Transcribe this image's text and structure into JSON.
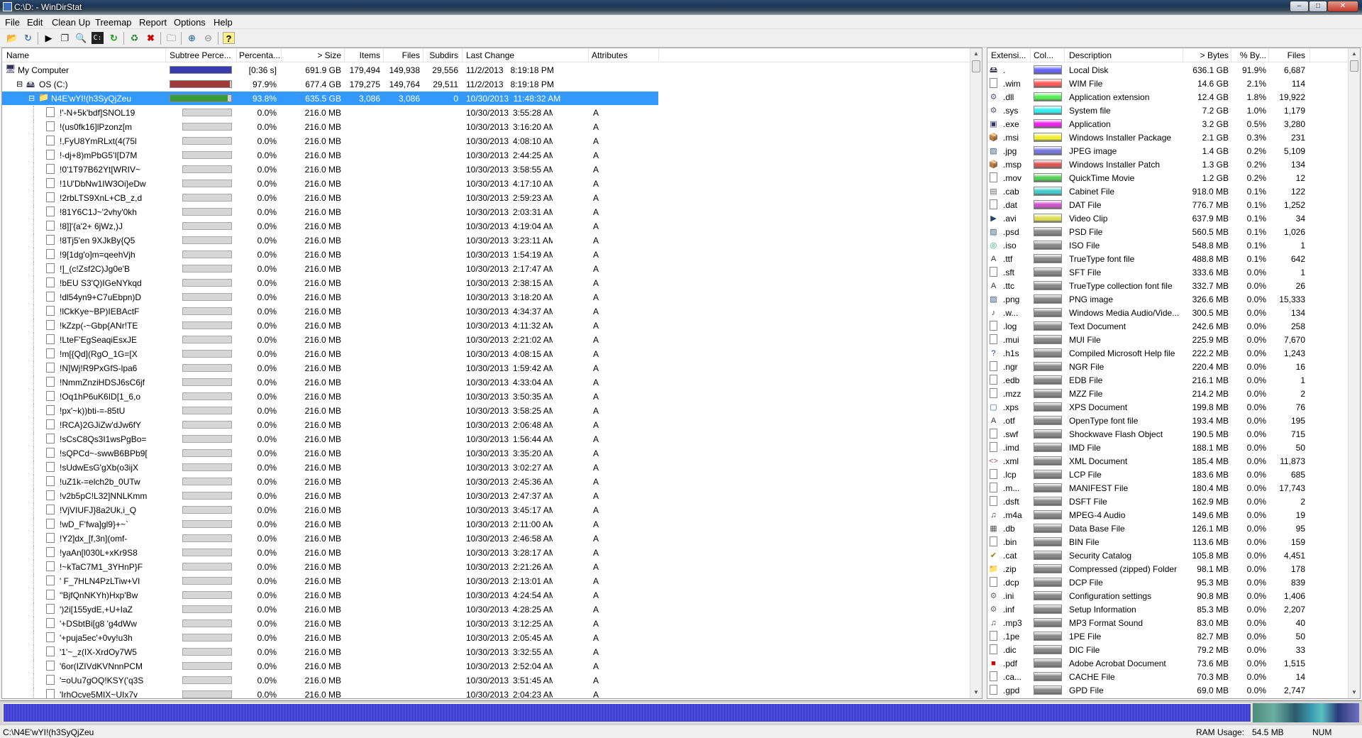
{
  "window": {
    "title": "C:\\D: - WinDirStat"
  },
  "menu": [
    "File",
    "Edit",
    "Clean Up",
    "Treemap",
    "Report",
    "Options",
    "Help"
  ],
  "colors": {
    "computer_bar": "#3b3bb0",
    "drive_bar": "#a03a3a",
    "folder_bar": "#3a9a3a",
    "selection": "#3399ff"
  },
  "toolbar_icons": [
    "open-icon",
    "refresh-all-icon",
    "play-icon",
    "copy-path-icon",
    "explorer-here-icon",
    "command-prompt-icon",
    "refresh-icon",
    "recycle-icon",
    "delete-icon",
    "properties-icon",
    "zoom-in-icon",
    "zoom-out-icon",
    "help-icon"
  ],
  "dir_columns": {
    "name": "Name",
    "subtree": "Subtree Perce...",
    "percent": "Percenta...",
    "size": "> Size",
    "items": "Items",
    "files": "Files",
    "subdirs": "Subdirs",
    "last_change": "Last Change",
    "attributes": "Attributes"
  },
  "tree_top": [
    {
      "name": "My Computer",
      "bar_fill": 1.0,
      "percent": "[0:36 s]",
      "size": "691.9 GB",
      "items": "179,494",
      "files": "149,938",
      "subdirs": "29,556",
      "last_change": "11/2/2013   8:19:18 PM",
      "attributes": "",
      "expand": "",
      "level": 0
    },
    {
      "name": "OS (C:)",
      "bar_fill": 0.979,
      "percent": "97.9%",
      "size": "677.4 GB",
      "items": "179,275",
      "files": "149,764",
      "subdirs": "29,511",
      "last_change": "11/2/2013   8:19:18 PM",
      "attributes": "",
      "expand": "⊟",
      "level": 1
    },
    {
      "name": "N4E'wYI!(h3SyQjZeu",
      "bar_fill": 0.938,
      "percent": "93.8%",
      "size": "635.5 GB",
      "items": "3,086",
      "files": "3,086",
      "subdirs": "0",
      "last_change": "10/30/2013  11:48:32 AM",
      "attributes": "",
      "expand": "⊟",
      "level": 2
    }
  ],
  "files": [
    {
      "name": "!'-N+5k'bdf]SNOL19",
      "time": "3:55:28 AM"
    },
    {
      "name": "!(us0fk16]lPzonz[m",
      "time": "3:16:20 AM"
    },
    {
      "name": "!,FyU8YmRLxt(4(75l",
      "time": "4:08:10 AM"
    },
    {
      "name": "!-dj+8)mPbG5'I[D7M",
      "time": "2:44:25 AM"
    },
    {
      "name": "!0'1T97B62Yt[WRIV~",
      "time": "3:58:55 AM"
    },
    {
      "name": "!1U'DbNw1IW3Oi}eDw",
      "time": "4:17:10 AM"
    },
    {
      "name": "!2rbLTS9XnL+CB_z,d",
      "time": "2:59:23 AM"
    },
    {
      "name": "!81Y6C1J~'2vhy'0kh",
      "time": "2:03:31 AM"
    },
    {
      "name": "!8]]'{a'2+ 6jWz,)J",
      "time": "4:19:04 AM"
    },
    {
      "name": "!8Tj5'en 9XJkBy{Q5",
      "time": "3:23:11 AM"
    },
    {
      "name": "!9[1dg'o]m=qeehVjh",
      "time": "1:54:19 AM"
    },
    {
      "name": "!]_(c!Zsf2C)Jg0e'B",
      "time": "2:17:47 AM"
    },
    {
      "name": "!bEU S3'Q)IGeNYkqd",
      "time": "2:38:15 AM"
    },
    {
      "name": "!dl54yn9+C7uEbpn)D",
      "time": "3:18:20 AM"
    },
    {
      "name": "!lCkKye~BP)IEBActF",
      "time": "4:34:37 AM"
    },
    {
      "name": "!kZzp(-~Gbp{ANr!TE",
      "time": "4:11:32 AM"
    },
    {
      "name": "!LteF'EgSeaqiEsxJE",
      "time": "2:21:02 AM"
    },
    {
      "name": "!m[{Qd](RgO_1G=[X",
      "time": "4:08:15 AM"
    },
    {
      "name": "!N]Wj!R9PxGfS-lpa6",
      "time": "1:59:42 AM"
    },
    {
      "name": "!NmmZnziHDSJ6sC6jf",
      "time": "4:33:04 AM"
    },
    {
      "name": "!Oq1hP6uK6ID[1_6,o",
      "time": "3:50:35 AM"
    },
    {
      "name": "!px'~k))bti-=-85tU",
      "time": "3:58:25 AM"
    },
    {
      "name": "!RCA}2GJiZw'dJw6fY",
      "time": "2:06:48 AM"
    },
    {
      "name": "!sCsC8Qs3I1wsPgBo=",
      "time": "1:56:44 AM"
    },
    {
      "name": "!sQPCd~-swwB6BPb9[",
      "time": "3:35:20 AM"
    },
    {
      "name": "!sUdwEsG'gXb(o3ijX",
      "time": "3:02:27 AM"
    },
    {
      "name": "!uZ1k-=elch2b_0UTw",
      "time": "2:45:36 AM"
    },
    {
      "name": "!v2b5pC!L32]NNLKmm",
      "time": "2:47:37 AM"
    },
    {
      "name": "!VjVIUFJ}8a2Uk,i_Q",
      "time": "3:45:17 AM"
    },
    {
      "name": "!wD_F'fwa]gl9}+~`",
      "time": "2:11:00 AM"
    },
    {
      "name": "!Y2]dx_[f,3n](omf-",
      "time": "2:46:58 AM"
    },
    {
      "name": "!yaAn[l030L+xKr9S8",
      "time": "3:28:17 AM"
    },
    {
      "name": "!~kTaC7M1_3YHnP}F",
      "time": "2:21:26 AM"
    },
    {
      "name": "' F_7HLN4PzLTiw+VI",
      "time": "2:13:01 AM"
    },
    {
      "name": "''BjfQnNKYh)Hxp'Bw",
      "time": "4:24:54 AM"
    },
    {
      "name": "')2i[155ydE,+U+IaZ",
      "time": "4:28:25 AM"
    },
    {
      "name": "'+DSbtBi[g8 'g4dWw",
      "time": "3:12:25 AM"
    },
    {
      "name": "'+puja5ec'+0vy!u3h",
      "time": "2:05:45 AM"
    },
    {
      "name": "'1'~_z(IX-XrdOy7W5",
      "time": "3:32:55 AM"
    },
    {
      "name": "'6or(IZIVdKVNnnPCM",
      "time": "2:52:04 AM"
    },
    {
      "name": "'=oUu7gOQ!KSY('q3S",
      "time": "3:51:45 AM"
    },
    {
      "name": "'IrhOcve5MIX~UIx7v",
      "time": "2:04:23 AM"
    }
  ],
  "file_common": {
    "percent": "0.0%",
    "size": "216.0 MB",
    "date": "10/30/2013",
    "attributes": "A",
    "bar_fill": 0.0
  },
  "ext_columns": {
    "ext": "Extensi...",
    "color": "Col...",
    "description": "Description",
    "bytes": "> Bytes",
    "percent": "% By...",
    "files": "Files"
  },
  "extensions": [
    {
      "ext": ".",
      "color": "#6666ff",
      "icon": "disk-icon",
      "desc": "Local Disk",
      "bytes": "636.1 GB",
      "pct": "91.9%",
      "files": "6,687"
    },
    {
      "ext": ".wim",
      "color": "#ff5a5a",
      "icon": "file-icon",
      "desc": "WIM File",
      "bytes": "14.6 GB",
      "pct": "2.1%",
      "files": "114"
    },
    {
      "ext": ".dll",
      "color": "#55ee55",
      "icon": "gear-icon",
      "desc": "Application extension",
      "bytes": "12.4 GB",
      "pct": "1.8%",
      "files": "19,922"
    },
    {
      "ext": ".sys",
      "color": "#33eeee",
      "icon": "gear-icon",
      "desc": "System file",
      "bytes": "7.2 GB",
      "pct": "1.0%",
      "files": "1,179"
    },
    {
      "ext": ".exe",
      "color": "#ee22ee",
      "icon": "app-icon",
      "desc": "Application",
      "bytes": "3.2 GB",
      "pct": "0.5%",
      "files": "3,280"
    },
    {
      "ext": ".msi",
      "color": "#eeee33",
      "icon": "installer-icon",
      "desc": "Windows Installer Package",
      "bytes": "2.1 GB",
      "pct": "0.3%",
      "files": "231"
    },
    {
      "ext": ".jpg",
      "color": "#7777dd",
      "icon": "image-icon",
      "desc": "JPEG image",
      "bytes": "1.4 GB",
      "pct": "0.2%",
      "files": "5,109"
    },
    {
      "ext": ".msp",
      "color": "#dd5555",
      "icon": "installer-icon",
      "desc": "Windows Installer Patch",
      "bytes": "1.3 GB",
      "pct": "0.2%",
      "files": "134"
    },
    {
      "ext": ".mov",
      "color": "#55cc55",
      "icon": "file-icon",
      "desc": "QuickTime Movie",
      "bytes": "1.2 GB",
      "pct": "0.2%",
      "files": "12"
    },
    {
      "ext": ".cab",
      "color": "#44cccc",
      "icon": "archive-icon",
      "desc": "Cabinet File",
      "bytes": "918.0 MB",
      "pct": "0.1%",
      "files": "122"
    },
    {
      "ext": ".dat",
      "color": "#cc55cc",
      "icon": "file-icon",
      "desc": "DAT File",
      "bytes": "776.7 MB",
      "pct": "0.1%",
      "files": "1,252"
    },
    {
      "ext": ".avi",
      "color": "#dddd55",
      "icon": "video-icon",
      "desc": "Video Clip",
      "bytes": "637.9 MB",
      "pct": "0.1%",
      "files": "34"
    },
    {
      "ext": ".psd",
      "color": "#888888",
      "icon": "image-icon",
      "desc": "PSD File",
      "bytes": "560.5 MB",
      "pct": "0.1%",
      "files": "1,026"
    },
    {
      "ext": ".iso",
      "color": "#888888",
      "icon": "disc-icon",
      "desc": "ISO File",
      "bytes": "548.8 MB",
      "pct": "0.1%",
      "files": "1"
    },
    {
      "ext": ".ttf",
      "color": "#888888",
      "icon": "font-icon",
      "desc": "TrueType font file",
      "bytes": "488.8 MB",
      "pct": "0.1%",
      "files": "642"
    },
    {
      "ext": ".sft",
      "color": "#888888",
      "icon": "file-icon",
      "desc": "SFT File",
      "bytes": "333.6 MB",
      "pct": "0.0%",
      "files": "1"
    },
    {
      "ext": ".ttc",
      "color": "#888888",
      "icon": "font-icon",
      "desc": "TrueType collection font file",
      "bytes": "332.7 MB",
      "pct": "0.0%",
      "files": "26"
    },
    {
      "ext": ".png",
      "color": "#888888",
      "icon": "image-icon",
      "desc": "PNG image",
      "bytes": "326.6 MB",
      "pct": "0.0%",
      "files": "15,333"
    },
    {
      "ext": ".w...",
      "color": "#888888",
      "icon": "media-icon",
      "desc": "Windows Media Audio/Vide...",
      "bytes": "300.5 MB",
      "pct": "0.0%",
      "files": "134"
    },
    {
      "ext": ".log",
      "color": "#888888",
      "icon": "file-icon",
      "desc": "Text Document",
      "bytes": "242.6 MB",
      "pct": "0.0%",
      "files": "258"
    },
    {
      "ext": ".mui",
      "color": "#888888",
      "icon": "file-icon",
      "desc": "MUI File",
      "bytes": "225.9 MB",
      "pct": "0.0%",
      "files": "7,670"
    },
    {
      "ext": ".h1s",
      "color": "#888888",
      "icon": "help-file-icon",
      "desc": "Compiled Microsoft Help file",
      "bytes": "222.2 MB",
      "pct": "0.0%",
      "files": "1,243"
    },
    {
      "ext": ".ngr",
      "color": "#888888",
      "icon": "file-icon",
      "desc": "NGR File",
      "bytes": "220.4 MB",
      "pct": "0.0%",
      "files": "16"
    },
    {
      "ext": ".edb",
      "color": "#888888",
      "icon": "file-icon",
      "desc": "EDB File",
      "bytes": "216.1 MB",
      "pct": "0.0%",
      "files": "1"
    },
    {
      "ext": ".mzz",
      "color": "#888888",
      "icon": "file-icon",
      "desc": "MZZ File",
      "bytes": "214.2 MB",
      "pct": "0.0%",
      "files": "2"
    },
    {
      "ext": ".xps",
      "color": "#888888",
      "icon": "xps-icon",
      "desc": "XPS Document",
      "bytes": "199.8 MB",
      "pct": "0.0%",
      "files": "76"
    },
    {
      "ext": ".otf",
      "color": "#888888",
      "icon": "font-icon",
      "desc": "OpenType font file",
      "bytes": "193.4 MB",
      "pct": "0.0%",
      "files": "195"
    },
    {
      "ext": ".swf",
      "color": "#888888",
      "icon": "file-icon",
      "desc": "Shockwave Flash Object",
      "bytes": "190.5 MB",
      "pct": "0.0%",
      "files": "715"
    },
    {
      "ext": ".imd",
      "color": "#888888",
      "icon": "file-icon",
      "desc": "IMD File",
      "bytes": "188.1 MB",
      "pct": "0.0%",
      "files": "50"
    },
    {
      "ext": ".xml",
      "color": "#888888",
      "icon": "xml-icon",
      "desc": "XML Document",
      "bytes": "185.4 MB",
      "pct": "0.0%",
      "files": "11,873"
    },
    {
      "ext": ".lcp",
      "color": "#888888",
      "icon": "file-icon",
      "desc": "LCP File",
      "bytes": "183.6 MB",
      "pct": "0.0%",
      "files": "685"
    },
    {
      "ext": ".m...",
      "color": "#888888",
      "icon": "file-icon",
      "desc": "MANIFEST File",
      "bytes": "180.4 MB",
      "pct": "0.0%",
      "files": "17,743"
    },
    {
      "ext": ".dsft",
      "color": "#888888",
      "icon": "file-icon",
      "desc": "DSFT File",
      "bytes": "162.9 MB",
      "pct": "0.0%",
      "files": "2"
    },
    {
      "ext": ".m4a",
      "color": "#888888",
      "icon": "audio-icon",
      "desc": "MPEG-4 Audio",
      "bytes": "149.6 MB",
      "pct": "0.0%",
      "files": "19"
    },
    {
      "ext": ".db",
      "color": "#888888",
      "icon": "database-icon",
      "desc": "Data Base File",
      "bytes": "126.1 MB",
      "pct": "0.0%",
      "files": "95"
    },
    {
      "ext": ".bin",
      "color": "#888888",
      "icon": "file-icon",
      "desc": "BIN File",
      "bytes": "113.6 MB",
      "pct": "0.0%",
      "files": "159"
    },
    {
      "ext": ".cat",
      "color": "#888888",
      "icon": "security-catalog-icon",
      "desc": "Security Catalog",
      "bytes": "105.8 MB",
      "pct": "0.0%",
      "files": "4,451"
    },
    {
      "ext": ".zip",
      "color": "#888888",
      "icon": "zip-folder-icon",
      "desc": "Compressed (zipped) Folder",
      "bytes": "98.1 MB",
      "pct": "0.0%",
      "files": "178"
    },
    {
      "ext": ".dcp",
      "color": "#888888",
      "icon": "file-icon",
      "desc": "DCP File",
      "bytes": "95.3 MB",
      "pct": "0.0%",
      "files": "839"
    },
    {
      "ext": ".ini",
      "color": "#888888",
      "icon": "settings-file-icon",
      "desc": "Configuration settings",
      "bytes": "90.8 MB",
      "pct": "0.0%",
      "files": "1,406"
    },
    {
      "ext": ".inf",
      "color": "#888888",
      "icon": "settings-file-icon",
      "desc": "Setup Information",
      "bytes": "85.3 MB",
      "pct": "0.0%",
      "files": "2,207"
    },
    {
      "ext": ".mp3",
      "color": "#888888",
      "icon": "audio-icon",
      "desc": "MP3 Format Sound",
      "bytes": "83.0 MB",
      "pct": "0.0%",
      "files": "40"
    },
    {
      "ext": ".1pe",
      "color": "#888888",
      "icon": "file-icon",
      "desc": "1PE File",
      "bytes": "82.7 MB",
      "pct": "0.0%",
      "files": "50"
    },
    {
      "ext": ".dic",
      "color": "#888888",
      "icon": "file-icon",
      "desc": "DIC File",
      "bytes": "79.2 MB",
      "pct": "0.0%",
      "files": "33"
    },
    {
      "ext": ".pdf",
      "color": "#888888",
      "icon": "pdf-icon",
      "desc": "Adobe Acrobat Document",
      "bytes": "73.6 MB",
      "pct": "0.0%",
      "files": "1,515"
    },
    {
      "ext": ".ca...",
      "color": "#888888",
      "icon": "file-icon",
      "desc": "CACHE File",
      "bytes": "70.3 MB",
      "pct": "0.0%",
      "files": "14"
    },
    {
      "ext": ".gpd",
      "color": "#888888",
      "icon": "file-icon",
      "desc": "GPD File",
      "bytes": "69.0 MB",
      "pct": "0.0%",
      "files": "2,747"
    }
  ],
  "status": {
    "path": "C:\\N4E'wYI!(h3SyQjZeu",
    "ram_label": "RAM Usage:",
    "ram_value": "54.5 MB",
    "num": "NUM"
  }
}
